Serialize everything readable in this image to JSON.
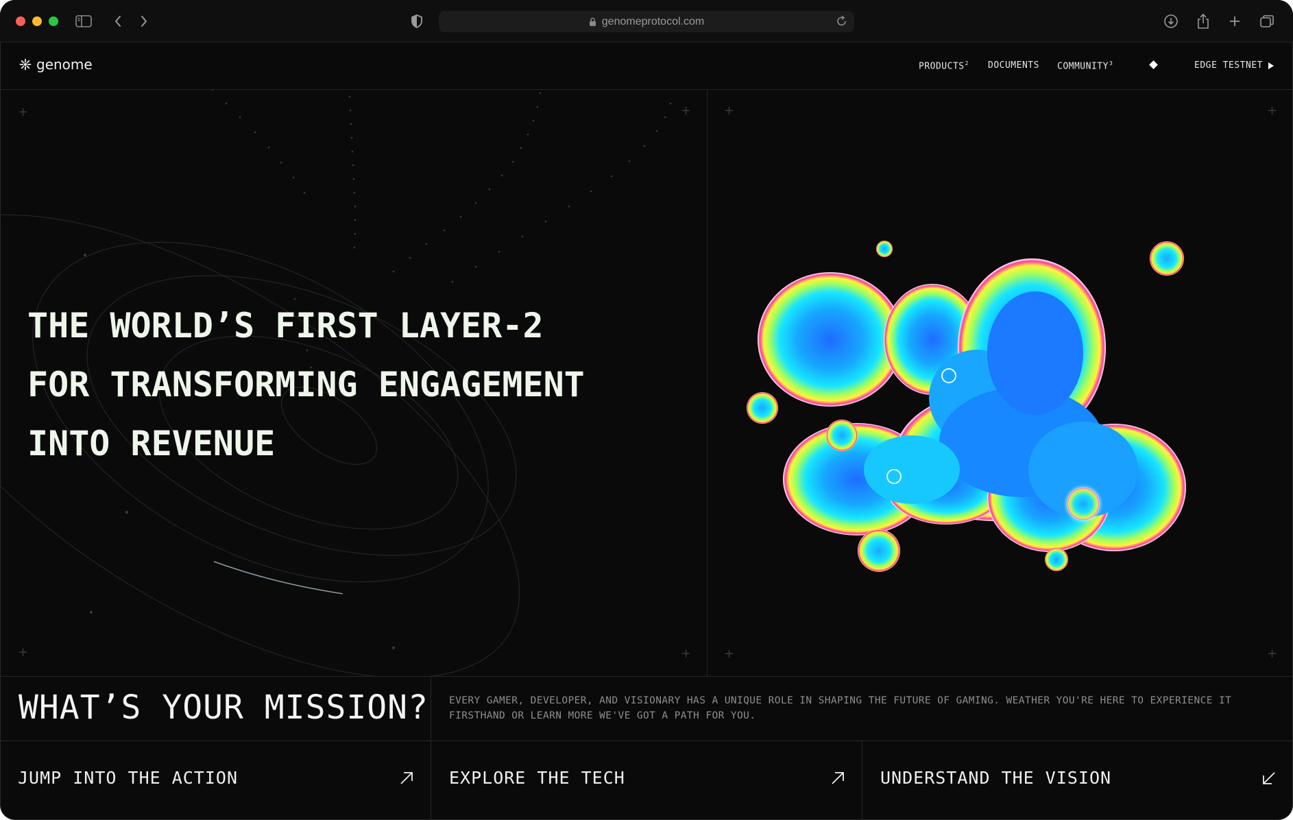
{
  "browser": {
    "url": "genomeprotocol.com"
  },
  "nav": {
    "logo_text": "genome",
    "products_label": "PRODUCTS",
    "products_sup": "2",
    "documents_label": "DOCUMENTS",
    "community_label": "COMMUNITY",
    "community_sup": "3",
    "cta_label": "EDGE TESTNET"
  },
  "hero": {
    "title_lines": [
      "THE WORLD’S FIRST LAYER-2",
      "FOR TRANSFORMING ENGAGEMENT",
      "INTO REVENUE"
    ]
  },
  "mission": {
    "title": "WHAT’S YOUR MISSION?",
    "description": "EVERY GAMER, DEVELOPER, AND VISIONARY HAS A UNIQUE ROLE IN SHAPING THE FUTURE OF GAMING. WEATHER YOU'RE HERE TO EXPERIENCE IT FIRSTHAND OR LEARN MORE WE'VE GOT A PATH FOR YOU."
  },
  "ctas": [
    {
      "label": "JUMP INTO THE ACTION",
      "arrow": "arrow-up-right-icon"
    },
    {
      "label": "EXPLORE THE TECH",
      "arrow": "arrow-up-right-icon"
    },
    {
      "label": "UNDERSTAND THE VISION",
      "arrow": "arrow-down-left-icon"
    }
  ],
  "colors": {
    "background": "#0a0a0a",
    "hero_text": "#eef5ea",
    "muted_text": "#8e8e8e"
  }
}
